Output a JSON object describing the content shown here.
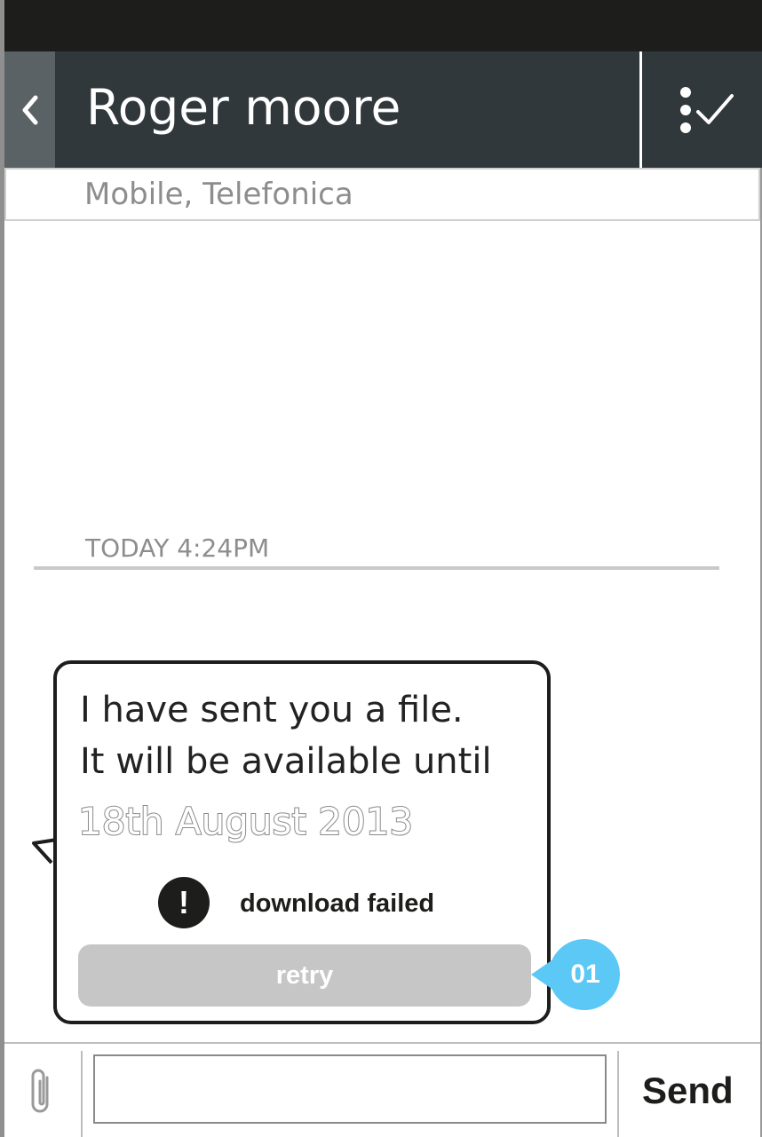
{
  "header": {
    "title": "Roger moore",
    "back_icon": "chevron-left-icon",
    "action_icon": "dots-check-icon"
  },
  "contact": {
    "subtitle": "Mobile, Telefonica"
  },
  "conversation": {
    "timestamp": "TODAY 4:24PM",
    "message": {
      "line1": "I have sent you a file.",
      "line2": "It will be available until",
      "date": "18th August 2013",
      "error_icon": "exclamation-icon",
      "error_text": "download failed",
      "retry_label": "retry"
    }
  },
  "annotation": {
    "label": "01",
    "color": "#5bc8f5"
  },
  "composer": {
    "attach_icon": "paperclip-icon",
    "input_value": "",
    "send_label": "Send"
  },
  "colors": {
    "header_bg": "#30383b",
    "status_bar": "#1d1e1c",
    "retry_bg": "#c6c6c6"
  }
}
